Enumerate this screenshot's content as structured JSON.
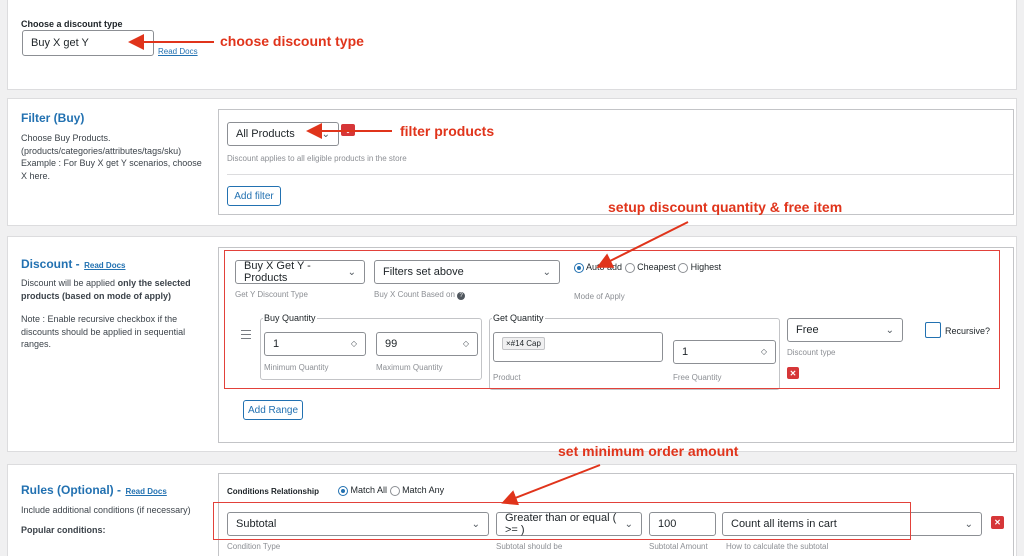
{
  "discount_type": {
    "label": "Choose a discount type",
    "value": "Buy X get Y",
    "docs": "Read Docs"
  },
  "filter": {
    "title": "Filter (Buy)",
    "desc1": "Choose Buy Products.",
    "desc2": "(products/categories/attributes/tags/sku)",
    "desc3": "Example : For Buy X get Y scenarios, choose",
    "desc4": "X here.",
    "select_value": "All Products",
    "hint": "Discount applies to all eligible products in the store",
    "add_filter": "Add filter"
  },
  "discount": {
    "title": "Discount -",
    "docs": "Read Docs",
    "desc_a": "Discount will be applied",
    "desc_b": "only the selected",
    "desc_c": "products (based on mode of apply)",
    "note1": "Note : Enable recursive checkbox if the",
    "note2": "discounts should be applied in sequential",
    "note3": "ranges.",
    "type_value": "Buy X Get Y - Products",
    "type_hint": "Get Y Discount Type",
    "count_value": "Filters set above",
    "count_hint": "Buy X Count Based on",
    "mode_auto": "Auto add",
    "mode_cheapest": "Cheapest",
    "mode_highest": "Highest",
    "mode_hint": "Mode of Apply",
    "buy_qty_legend": "Buy Quantity",
    "min_qty": "1",
    "min_hint": "Minimum Quantity",
    "max_qty": "99",
    "max_hint": "Maximum Quantity",
    "get_qty_legend": "Get Quantity",
    "product_tag": "×#14 Cap",
    "product_hint": "Product",
    "free_qty": "1",
    "free_qty_hint": "Free Quantity",
    "disc_type_value": "Free",
    "disc_type_hint": "Discount type",
    "recursive": "Recursive?",
    "add_range": "Add Range",
    "remove": "✕"
  },
  "rules": {
    "title": "Rules (Optional) -",
    "docs": "Read Docs",
    "desc": "Include additional conditions (if necessary)",
    "popular": "Popular conditions:",
    "cond_rel": "Conditions Relationship",
    "match_all": "Match All",
    "match_any": "Match Any",
    "cond_type": "Subtotal",
    "cond_type_hint": "Condition Type",
    "operator": "Greater than or equal ( >= )",
    "operator_hint": "Subtotal should be",
    "amount": "100",
    "amount_hint": "Subtotal Amount",
    "calc": "Count all items in cart",
    "calc_hint": "How to calculate the subtotal",
    "remove": "✕"
  },
  "annotations": {
    "a1": "choose discount type",
    "a2": "filter products",
    "a3": "setup discount quantity & free item",
    "a4": "set minimum order amount"
  },
  "colors": {
    "accent": "#2271b1",
    "annotation": "#e0341b",
    "danger": "#d63638"
  }
}
